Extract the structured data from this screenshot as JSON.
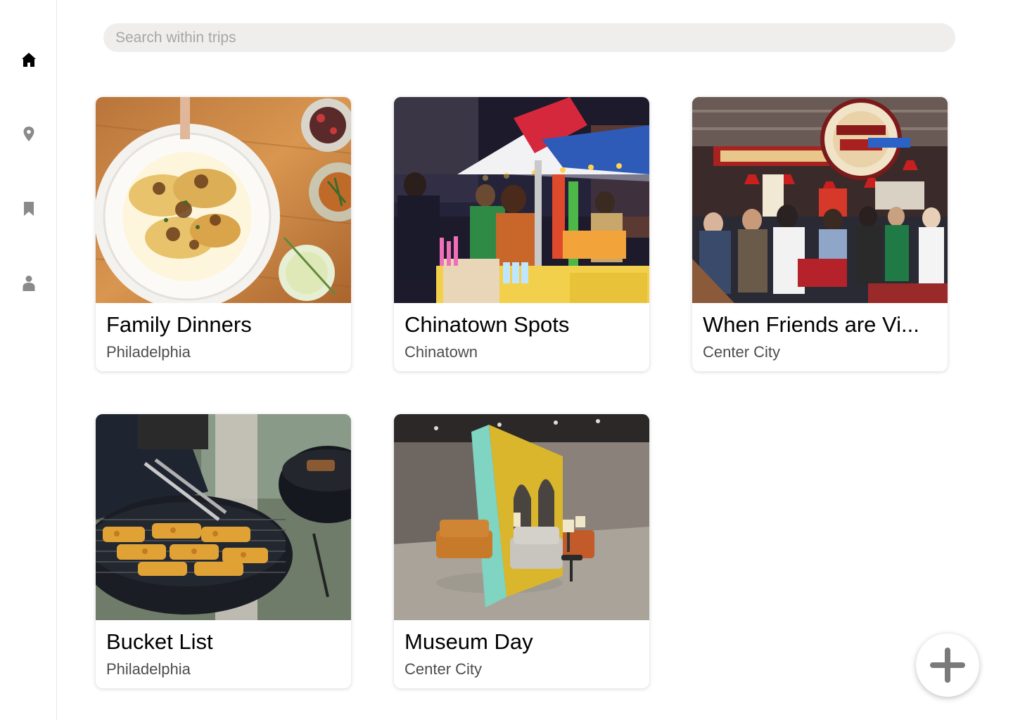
{
  "search": {
    "placeholder": "Search within trips",
    "value": ""
  },
  "sidebar": {
    "items": [
      {
        "name": "home",
        "icon": "home-icon",
        "active": true
      },
      {
        "name": "map",
        "icon": "location-pin-icon",
        "active": false
      },
      {
        "name": "saved",
        "icon": "bookmark-icon",
        "active": false
      },
      {
        "name": "profile",
        "icon": "person-icon",
        "active": false
      }
    ],
    "active_color": "#000000",
    "inactive_color": "#8a8a8a"
  },
  "trips": [
    {
      "title": "Family Dinners",
      "location": "Philadelphia",
      "image": "plate-of-pierogies-photo"
    },
    {
      "title": "Chinatown Spots",
      "location": "Chinatown",
      "image": "night-market-stall-photo"
    },
    {
      "title": "When Friends are Vi...",
      "location": "Center City",
      "image": "food-market-interior-photo"
    },
    {
      "title": "Bucket List",
      "location": "Philadelphia",
      "image": "grilling-skewers-photo"
    },
    {
      "title": "Museum Day",
      "location": "Center City",
      "image": "gallery-installation-photo"
    }
  ],
  "fab": {
    "icon": "plus-icon",
    "action": "add-trip"
  }
}
